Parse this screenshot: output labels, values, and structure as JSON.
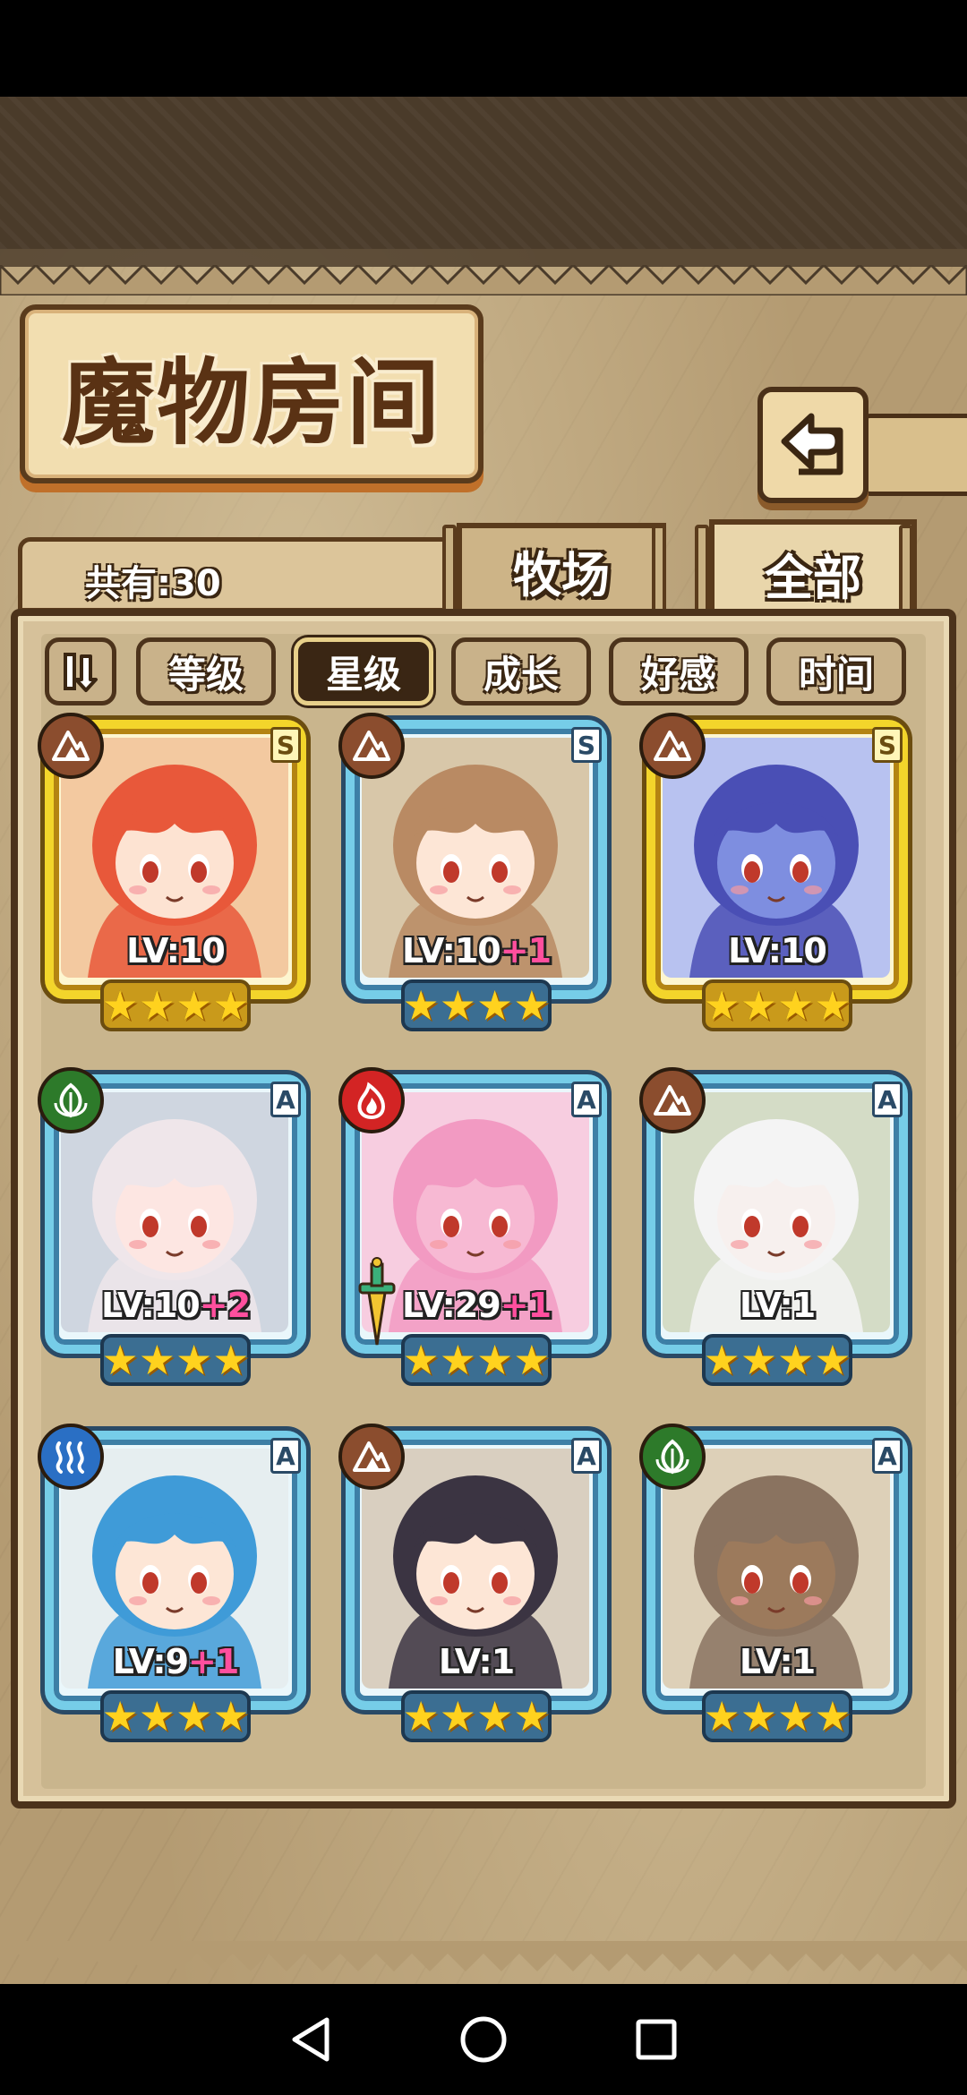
{
  "header": {
    "title": "魔物房间",
    "count_label": "共有:30"
  },
  "top_tabs": [
    {
      "label": "牧场",
      "active": false
    },
    {
      "label": "全部",
      "active": true
    }
  ],
  "sort_buttons": [
    {
      "label": "等级",
      "active": false
    },
    {
      "label": "星级",
      "active": true
    },
    {
      "label": "成长",
      "active": false
    },
    {
      "label": "好感",
      "active": false
    },
    {
      "label": "时间",
      "active": false
    }
  ],
  "monsters": [
    {
      "lv": "LV:10",
      "plus": "",
      "rank": "S",
      "frame": "gold",
      "element": "earth",
      "stars": 4,
      "hair": "#e8583a",
      "skin": "#fde3d2",
      "bg": "#f3c9a0",
      "equipped": false
    },
    {
      "lv": "LV:10",
      "plus": "+1",
      "rank": "S",
      "frame": "blue",
      "element": "earth",
      "stars": 4,
      "hair": "#b98a63",
      "skin": "#fde6d6",
      "bg": "#d8c7a9",
      "equipped": false
    },
    {
      "lv": "LV:10",
      "plus": "",
      "rank": "S",
      "frame": "gold",
      "element": "earth",
      "stars": 4,
      "hair": "#4a4fb5",
      "skin": "#7e8ee0",
      "bg": "#b8c2f0",
      "equipped": false
    },
    {
      "lv": "LV:10",
      "plus": "+2",
      "rank": "A",
      "frame": "blue",
      "element": "leaf",
      "stars": 4,
      "hair": "#efe6ea",
      "skin": "#fde6e2",
      "bg": "#cfd6e0",
      "equipped": false
    },
    {
      "lv": "LV:29",
      "plus": "+1",
      "rank": "A",
      "frame": "blue",
      "element": "fire",
      "stars": 4,
      "hair": "#f29ac2",
      "skin": "#f7b9d3",
      "bg": "#f7cde0",
      "equipped": true
    },
    {
      "lv": "LV:1",
      "plus": "",
      "rank": "A",
      "frame": "blue",
      "element": "earth",
      "stars": 4,
      "hair": "#f4f4f4",
      "skin": "#f7f0ee",
      "bg": "#d4dcc6",
      "equipped": false
    },
    {
      "lv": "LV:9",
      "plus": "+1",
      "rank": "A",
      "frame": "blue",
      "element": "water",
      "stars": 4,
      "hair": "#3f9bd8",
      "skin": "#fde6d6",
      "bg": "#e6eef0",
      "equipped": false
    },
    {
      "lv": "LV:1",
      "plus": "",
      "rank": "A",
      "frame": "blue",
      "element": "earth",
      "stars": 4,
      "hair": "#3b3442",
      "skin": "#fde6d6",
      "bg": "#d9cfc0",
      "equipped": false
    },
    {
      "lv": "LV:1",
      "plus": "",
      "rank": "A",
      "frame": "blue",
      "element": "leaf",
      "stars": 4,
      "hair": "#8a7360",
      "skin": "#9c7a5c",
      "bg": "#ddd0b8",
      "equipped": false
    }
  ],
  "element_colors": {
    "earth": "#8b4d2e",
    "leaf": "#2d7a2a",
    "fire": "#d32424",
    "water": "#2a6fc4"
  }
}
